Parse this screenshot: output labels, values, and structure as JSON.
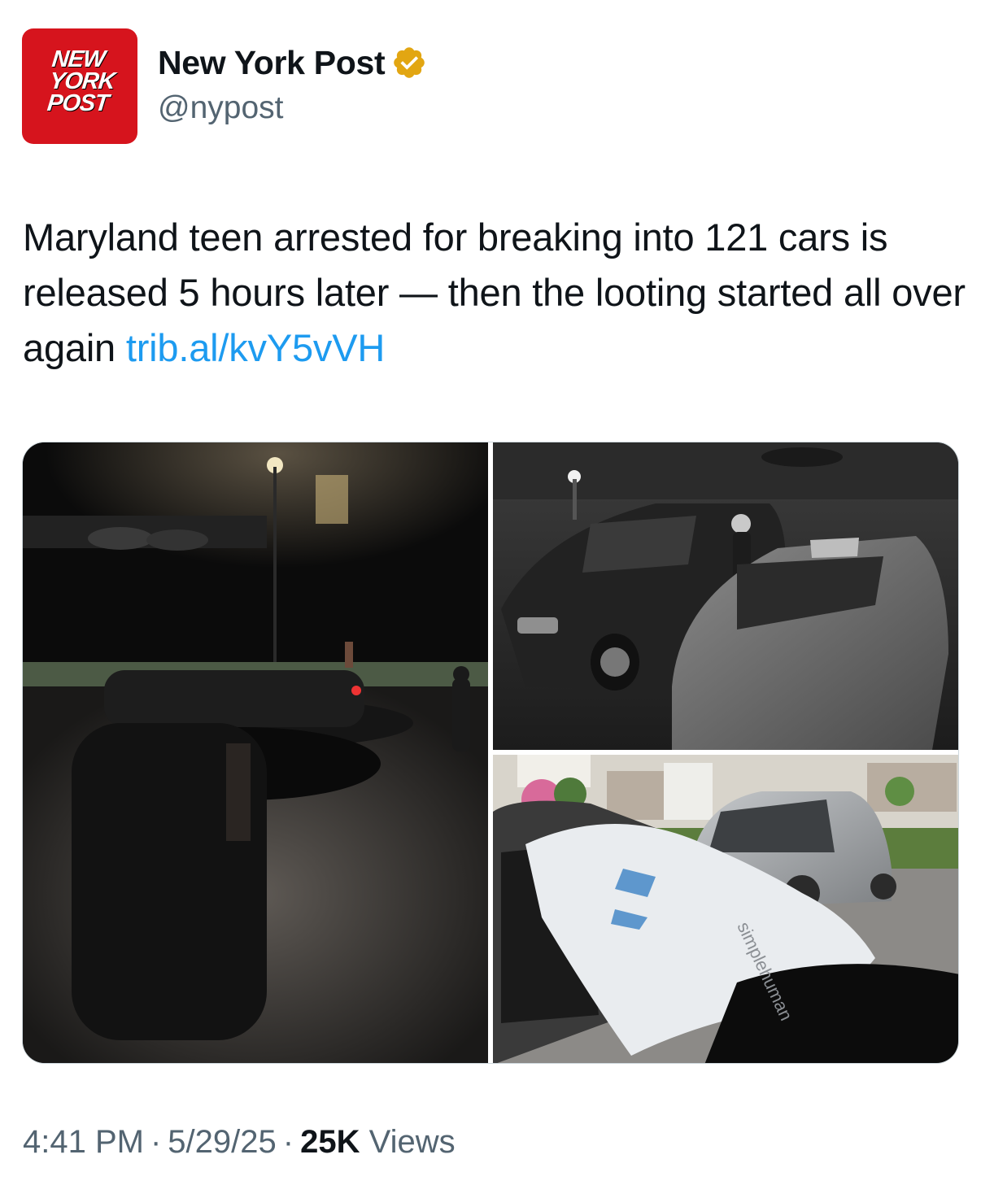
{
  "author": {
    "avatar_lines": [
      "NEW",
      "YORK",
      "POST"
    ],
    "display_name": "New York Post",
    "handle": "@nypost",
    "verified_badge_color": "#e2a612",
    "avatar_color": "#d6141d"
  },
  "tweet": {
    "text": "Maryland teen arrested for breaking into 121 cars is released 5 hours later — then the looting started all over again",
    "link": "trib.al/kvY5vVH",
    "link_color": "#1d9bf0"
  },
  "media": {
    "bag_text": "simplehuman"
  },
  "meta": {
    "time": "4:41 PM",
    "separator": "·",
    "date": "5/29/25",
    "views_count": "25K",
    "views_label": "Views"
  }
}
